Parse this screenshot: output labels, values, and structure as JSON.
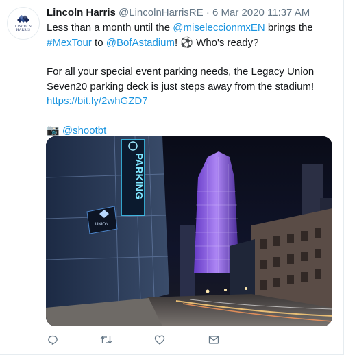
{
  "tweet": {
    "author_name": "Lincoln Harris",
    "author_handle": "@LincolnHarrisRE",
    "separator": "·",
    "timestamp": "6 Mar 2020 11:37 AM",
    "avatar_logo_text_line1": "LINCOLN",
    "avatar_logo_text_line2": "HARRIS",
    "text": {
      "p1_a": "Less than a month until the ",
      "p1_mention1": "@miseleccionmxEN",
      "p1_b": " brings the ",
      "p1_hashtag": "#MexTour",
      "p1_c": " to ",
      "p1_mention2": "@BofAstadium",
      "p1_d": "! ⚽ Who's ready?",
      "p2": "For all your special event parking needs, the Legacy Union Seven20 parking deck is just steps away from the stadium!",
      "p2_link": "https://bit.ly/2whGZD7",
      "p3_camera": "📷 ",
      "p3_mention": "@shootbt"
    },
    "media": {
      "sign_text": "PARKING",
      "sign_brand": "UNION",
      "description_icon": "city-night-photo"
    },
    "actions": [
      {
        "name": "reply",
        "icon": "reply-icon"
      },
      {
        "name": "retweet",
        "icon": "retweet-icon"
      },
      {
        "name": "like",
        "icon": "heart-icon"
      },
      {
        "name": "share",
        "icon": "envelope-icon"
      }
    ],
    "colors": {
      "link": "#1b95e0",
      "muted": "#657786",
      "text": "#14171a",
      "brand_logo": "#1a2a5a"
    }
  }
}
